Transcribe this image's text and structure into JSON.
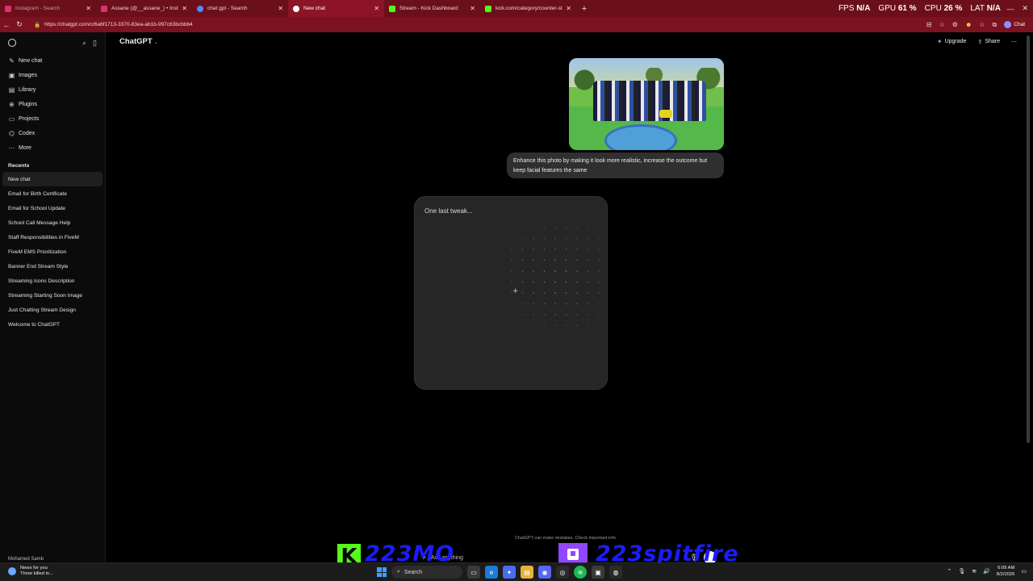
{
  "browser": {
    "tabs": [
      {
        "title": "Instagram - Search",
        "favicon_color": "#d6336c",
        "state": "dim"
      },
      {
        "title": "Assane (@__assane_) • Instagram",
        "favicon_color": "#d6336c",
        "state": "normal"
      },
      {
        "title": "chat gpt - Search",
        "favicon_color": "#4a8cff",
        "state": "normal"
      },
      {
        "title": "New chat",
        "favicon_color": "#ffffff",
        "state": "active"
      },
      {
        "title": "Stream - Kick Dashboard",
        "favicon_color": "#53fc18",
        "state": "normal"
      },
      {
        "title": "kick.com/category/counter-strike",
        "favicon_color": "#53fc18",
        "state": "normal"
      }
    ],
    "new_tab_icon": "+",
    "url": "https://chatgpt.com/c/6a6f1713-3370-83ea-ab1b-997c63bcbbb4",
    "perf": {
      "fps_label": "FPS",
      "fps_value": "N/A",
      "gpu_label": "GPU",
      "gpu_value": "61 %",
      "cpu_label": "CPU",
      "cpu_value": "26 %",
      "lat_label": "LAT",
      "lat_value": "N/A"
    },
    "chat_pill": "Chat"
  },
  "sidebar": {
    "items": [
      {
        "icon": "✎",
        "label": "New chat"
      },
      {
        "icon": "▣",
        "label": "Images"
      },
      {
        "icon": "▤",
        "label": "Library"
      },
      {
        "icon": "⊕",
        "label": "Plugins"
      },
      {
        "icon": "▭",
        "label": "Projects"
      },
      {
        "icon": "⌬",
        "label": "Codex"
      },
      {
        "icon": "⋯",
        "label": "More"
      }
    ],
    "recents_label": "Recents",
    "chats": [
      "New chat",
      "Email for Birth Certificate",
      "Email for School Update",
      "School Call Message Help",
      "Staff Responsibilities in FiveM",
      "FiveM EMS Prioritization",
      "Banner End Stream Style",
      "Streaming Icons Description",
      "Streaming Starting Soon Image",
      "Just Chatting Stream Design",
      "Welcome to ChatGPT"
    ],
    "user_name": "Mohamed Samb"
  },
  "header": {
    "model": "ChatGPT",
    "upgrade": "Upgrade",
    "share": "Share",
    "more": "⋯"
  },
  "conversation": {
    "user_message": "Enhance this photo by making it look more realistic, increase the outcome but keep facial features the same",
    "generating_status": "One last tweak..."
  },
  "footer": {
    "disclaimer": "ChatGPT can make mistakes. Check important info.",
    "composer_placeholder": "Ask anything"
  },
  "overlay": {
    "kick_letter": "K",
    "kick_handle": "223MO",
    "twitch_handle": "223spitfire"
  },
  "taskbar": {
    "news_title": "News for you",
    "news_sub": "Three killed in...",
    "search": "Search",
    "time": "6:09 AM",
    "date": "8/2/2026"
  },
  "colors": {
    "tabbar": "#6b0f1a",
    "kick_green": "#53fc18",
    "twitch_purple": "#9146ff",
    "overlay_text": "#1b1bff"
  }
}
